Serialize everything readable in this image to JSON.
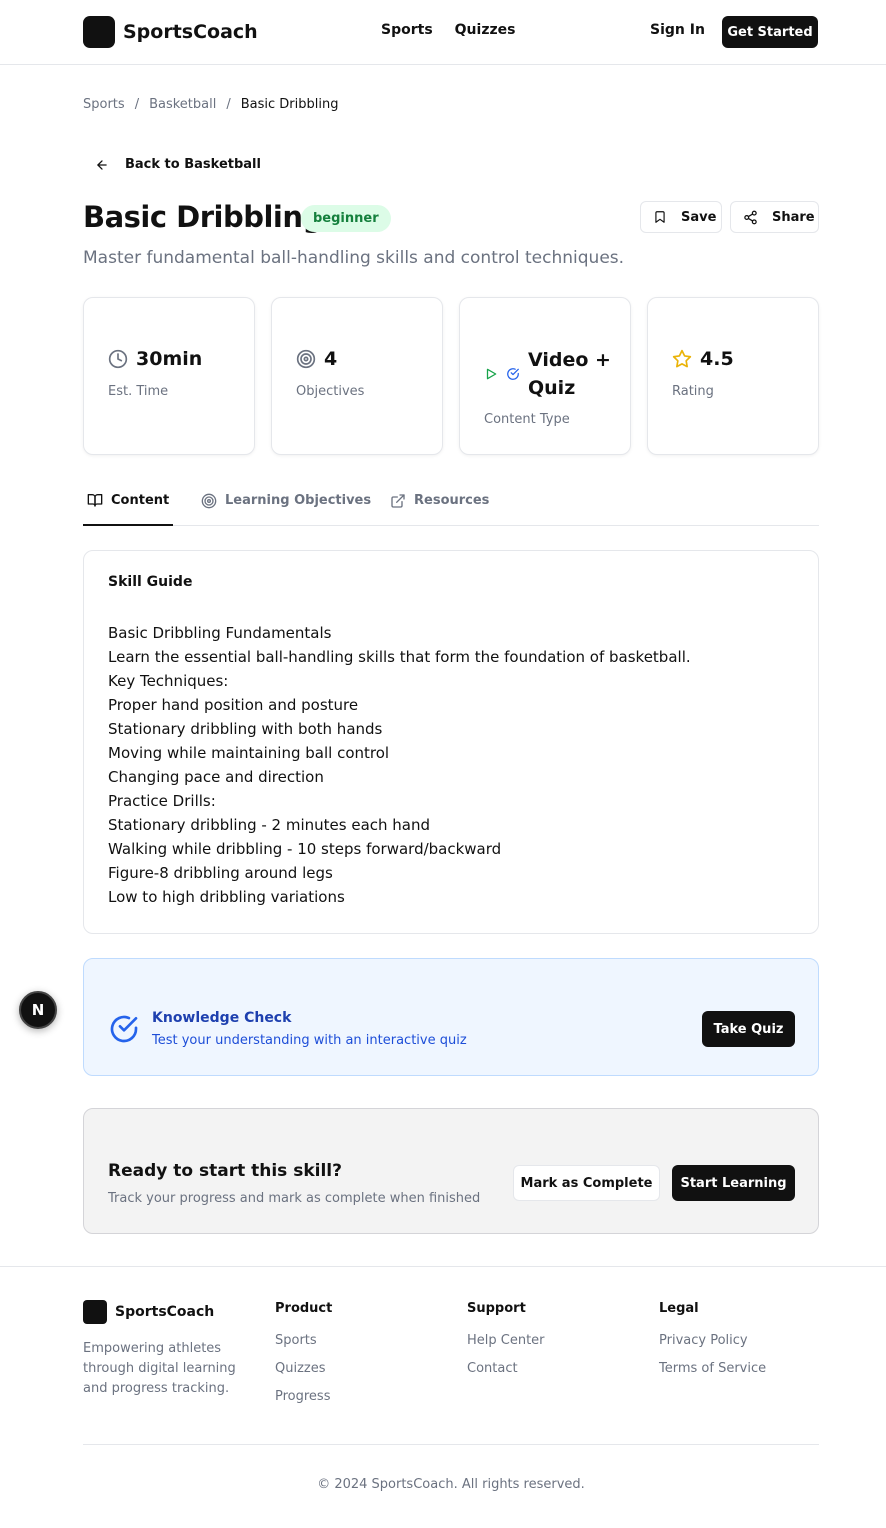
{
  "header": {
    "brand": "SportsCoach",
    "nav": [
      "Sports",
      "Quizzes"
    ],
    "sign_in": "Sign In",
    "get_started": "Get Started"
  },
  "breadcrumb": {
    "items": [
      "Sports",
      "Basketball",
      "Basic Dribbling"
    ],
    "separator": "/"
  },
  "back_link": "Back to Basketball",
  "skill": {
    "title": "Basic Dribbling",
    "level_badge": "beginner",
    "description": "Master fundamental ball-handling skills and control techniques.",
    "save_label": "Save",
    "share_label": "Share"
  },
  "stats": [
    {
      "value": "30min",
      "label": "Est. Time",
      "icon": "clock-icon"
    },
    {
      "value": "4",
      "label": "Objectives",
      "icon": "target-icon"
    },
    {
      "value": "Video + Quiz",
      "label": "Content Type",
      "icon": "play-check-icon"
    },
    {
      "value": "4.5",
      "label": "Rating",
      "icon": "star-icon"
    }
  ],
  "tabs": [
    {
      "label": "Content",
      "icon": "book-icon",
      "active": true
    },
    {
      "label": "Learning Objectives",
      "icon": "target-icon",
      "active": false
    },
    {
      "label": "Resources",
      "icon": "external-link-icon",
      "active": false
    }
  ],
  "guide": {
    "title": "Skill Guide",
    "lines": [
      "Basic Dribbling Fundamentals",
      "Learn the essential ball-handling skills that form the foundation of basketball.",
      "Key Techniques:",
      "Proper hand position and posture",
      "Stationary dribbling with both hands",
      "Moving while maintaining ball control",
      "Changing pace and direction",
      "Practice Drills:",
      "Stationary dribbling - 2 minutes each hand",
      "Walking while dribbling - 10 steps forward/backward",
      "Figure-8 dribbling around legs",
      "Low to high dribbling variations"
    ]
  },
  "knowledge_check": {
    "title": "Knowledge Check",
    "subtitle": "Test your understanding with an interactive quiz",
    "button": "Take Quiz"
  },
  "ready": {
    "title": "Ready to start this skill?",
    "subtitle": "Track your progress and mark as complete when finished",
    "mark_complete": "Mark as Complete",
    "start_learning": "Start Learning"
  },
  "floating_badge": "N",
  "footer": {
    "brand": "SportsCoach",
    "description": "Empowering athletes through digital learning and progress tracking.",
    "columns": [
      {
        "title": "Product",
        "links": [
          "Sports",
          "Quizzes",
          "Progress"
        ]
      },
      {
        "title": "Support",
        "links": [
          "Help Center",
          "Contact"
        ]
      },
      {
        "title": "Legal",
        "links": [
          "Privacy Policy",
          "Terms of Service"
        ]
      }
    ],
    "copyright": "© 2024 SportsCoach. All rights reserved."
  },
  "colors": {
    "primary": "#111111",
    "badge_bg": "#dcfce7",
    "badge_text": "#15803d",
    "info_bg": "#eff6ff",
    "info_text": "#1e40af",
    "muted": "#6b7280"
  }
}
